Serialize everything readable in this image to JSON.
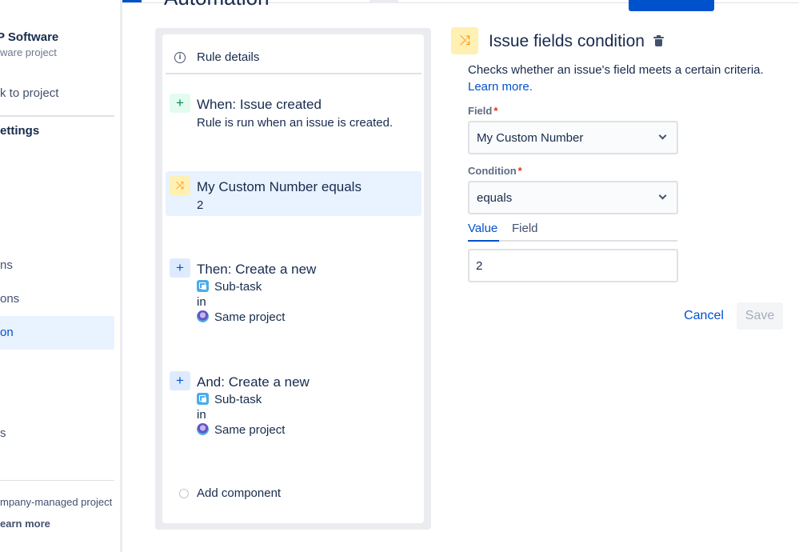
{
  "header": {
    "title": "Automation"
  },
  "sidebar": {
    "project_name": "P Software",
    "project_type": "ware project",
    "back_link": "k to project",
    "section_title": "ettings",
    "items": [
      {
        "label": "ns"
      },
      {
        "label": "ons"
      },
      {
        "label": "on"
      },
      {
        "label": "s"
      }
    ],
    "footer_note": "mpany-managed project",
    "footer_link": "earn more"
  },
  "rule": {
    "details_label": "Rule details",
    "trigger": {
      "title": "When: Issue created",
      "subtitle": "Rule is run when an issue is created."
    },
    "condition": {
      "title": "My Custom Number equals",
      "value": "2"
    },
    "actions": [
      {
        "title": "Then: Create a new",
        "issue_type": "Sub-task",
        "in_label": "in",
        "project": "Same project"
      },
      {
        "title": "And: Create a new",
        "issue_type": "Sub-task",
        "in_label": "in",
        "project": "Same project"
      }
    ],
    "add_component": "Add component"
  },
  "detail": {
    "title": "Issue fields condition",
    "description": "Checks whether an issue's field meets a certain criteria.",
    "learn_more": "Learn more.",
    "field_label": "Field",
    "field_value": "My Custom Number",
    "condition_label": "Condition",
    "condition_value": "equals",
    "tabs": [
      "Value",
      "Field"
    ],
    "value_input": "2",
    "cancel": "Cancel",
    "save": "Save"
  },
  "colors": {
    "primary": "#0052cc",
    "selected_bg": "#e9f2ff",
    "condition_icon_bg": "#fff0b3",
    "trigger_icon_bg": "#e3fcef",
    "action_icon_bg": "#deebff"
  }
}
